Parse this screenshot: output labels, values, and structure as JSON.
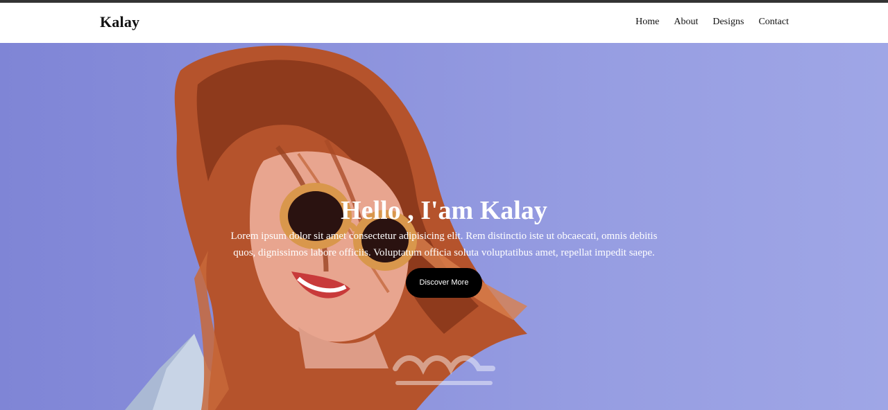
{
  "header": {
    "brand": "Kalay",
    "nav": [
      {
        "label": "Home"
      },
      {
        "label": "About"
      },
      {
        "label": "Designs"
      },
      {
        "label": "Contact"
      }
    ]
  },
  "hero": {
    "title": "Hello , I'am Kalay",
    "text": "Lorem ipsum dolor sit amet consectetur adipisicing elit. Rem distinctio iste ut obcaecati, omnis debitis quos, dignissimos labore officiis. Voluptatum officia soluta voluptatibus amet, repellat impedit saepe.",
    "button_label": "Discover More"
  },
  "colors": {
    "hero_background": "#8b91dc",
    "button": "#000000",
    "hair": "#b5532c"
  }
}
